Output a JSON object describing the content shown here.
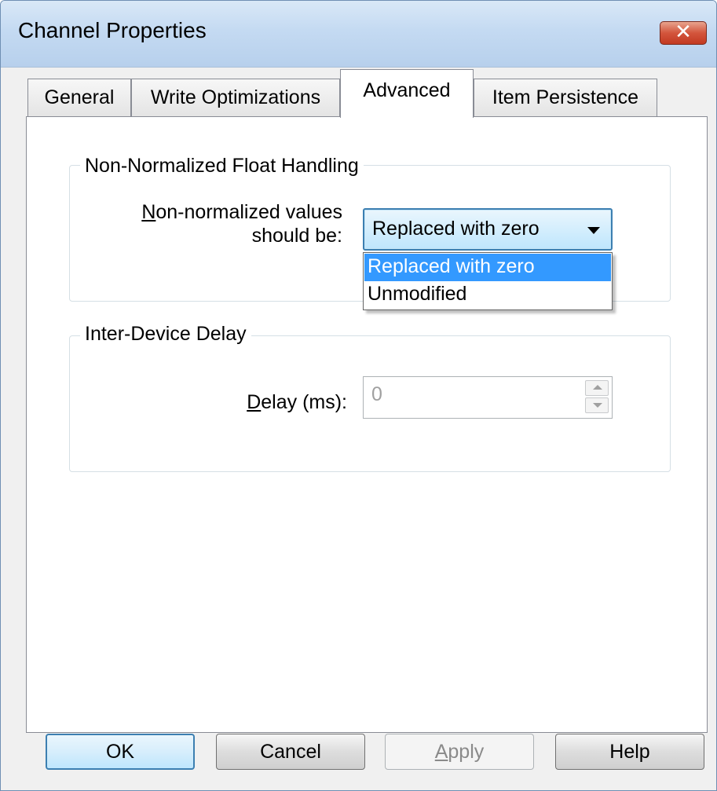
{
  "window": {
    "title": "Channel Properties"
  },
  "tabs": [
    {
      "label": "General"
    },
    {
      "label": "Write Optimizations"
    },
    {
      "label": "Advanced"
    },
    {
      "label": "Item Persistence"
    }
  ],
  "float_group": {
    "title": "Non-Normalized Float Handling",
    "label_line1_first": "N",
    "label_line1_rest": "on-normalized values",
    "label_line2": "should be:",
    "combo_value": "Replaced with zero",
    "options": [
      {
        "label": "Replaced with zero"
      },
      {
        "label": "Unmodified"
      }
    ]
  },
  "delay_group": {
    "title": "Inter-Device Delay",
    "label_first": "D",
    "label_rest": "elay (ms):",
    "value": "0"
  },
  "buttons": {
    "ok": "OK",
    "cancel": "Cancel",
    "apply_first": "A",
    "apply_rest": "pply",
    "help": "Help"
  },
  "icons": {
    "close": "close-icon",
    "combo_arrow": "chevron-down-icon",
    "spin_up": "spin-up-icon",
    "spin_down": "spin-down-icon"
  }
}
